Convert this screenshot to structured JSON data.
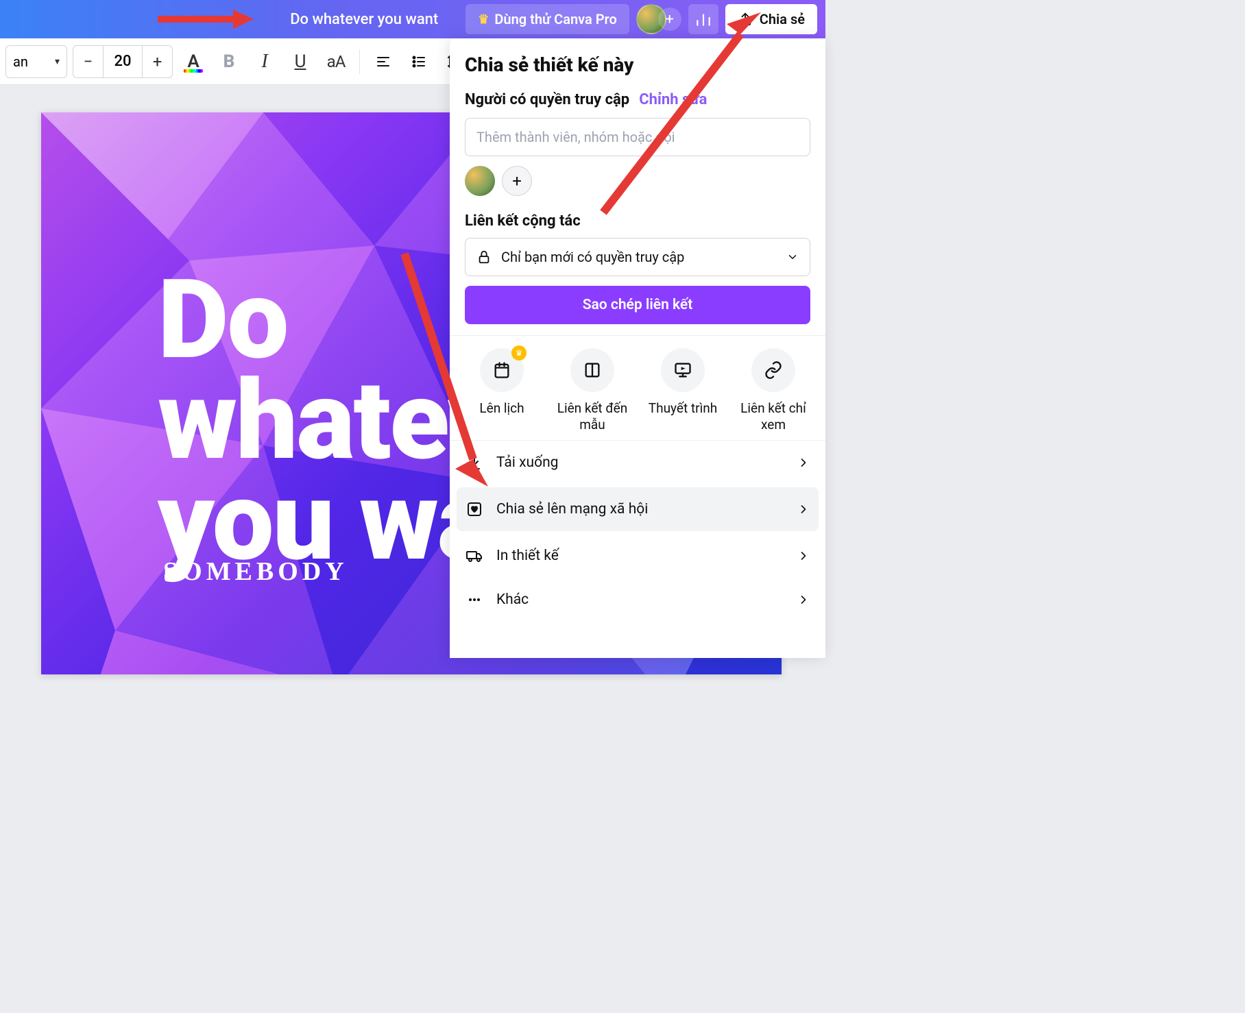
{
  "header": {
    "design_title": "Do whatever you want",
    "try_pro_label": "Dùng thử Canva Pro",
    "share_label": "Chia sẻ"
  },
  "toolbar": {
    "font_partial": "an",
    "font_size": "20"
  },
  "canvas": {
    "line1": "Do",
    "line2": "whatev",
    "line3": "you wa",
    "subtitle": "SOMEBODY"
  },
  "share_panel": {
    "title": "Chia sẻ thiết kế này",
    "access_label": "Người có quyền truy cập",
    "access_edit": "Chỉnh sửa",
    "member_placeholder": "Thêm thành viên, nhóm hoặc đội",
    "collab_label": "Liên kết cộng tác",
    "link_scope": "Chỉ bạn mới có quyền truy cập",
    "copy_link": "Sao chép liên kết",
    "quick": {
      "schedule": "Lên lịch",
      "template": "Liên kết đến mẫu",
      "present": "Thuyết trình",
      "viewonly": "Liên kết chỉ xem"
    },
    "list": {
      "download": "Tải xuống",
      "social": "Chia sẻ lên mạng xã hội",
      "print": "In thiết kế",
      "more": "Khác"
    }
  }
}
